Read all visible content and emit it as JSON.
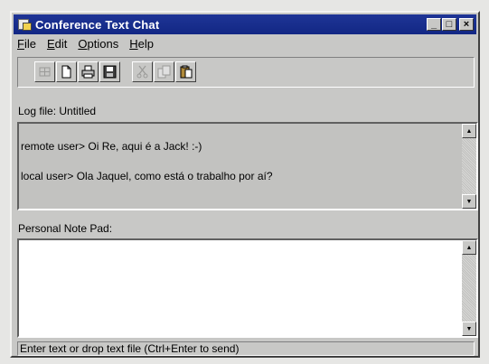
{
  "window": {
    "title": "Conference Text Chat"
  },
  "title_buttons": {
    "minimize": "_",
    "maximize": "□",
    "close": "×"
  },
  "menu": [
    {
      "underline": "F",
      "rest": "ile"
    },
    {
      "underline": "E",
      "rest": "dit"
    },
    {
      "underline": "O",
      "rest": "ptions"
    },
    {
      "underline": "H",
      "rest": "elp"
    }
  ],
  "toolbar": {
    "buttons": [
      {
        "icon": "grid-icon",
        "enabled": false
      },
      {
        "icon": "new-document-icon",
        "enabled": true
      },
      {
        "icon": "print-icon",
        "enabled": true
      },
      {
        "icon": "save-disk-icon",
        "enabled": true
      },
      {
        "icon": "cut-icon",
        "enabled": false
      },
      {
        "icon": "copy-icon",
        "enabled": false
      },
      {
        "icon": "paste-icon",
        "enabled": true
      }
    ]
  },
  "log": {
    "label": "Log file: Untitled",
    "messages": [
      "remote user> Oi Re, aqui é a Jack! :-)",
      "local user> Ola Jaquel, como está o trabalho por aí?"
    ]
  },
  "notepad": {
    "label": "Personal Note Pad:",
    "value": ""
  },
  "status": {
    "text": "Enter text or drop text file (Ctrl+Enter to send)"
  },
  "scroll_arrows": {
    "up": "▲",
    "down": "▼"
  },
  "colors": {
    "titlebar": "#1a2f8e",
    "window": "#c8c8c6",
    "log_bg": "#c2c2c0"
  }
}
